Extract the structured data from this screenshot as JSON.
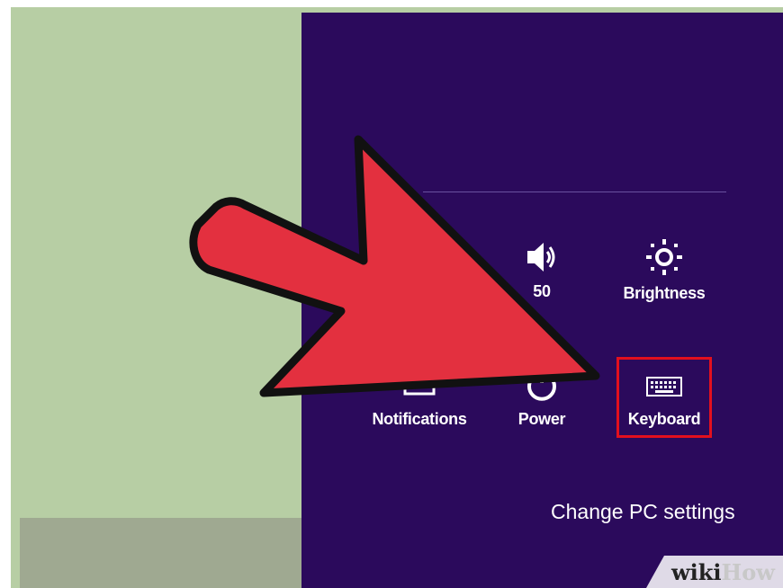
{
  "charm_panel": {
    "tiles_row1": [
      {
        "label": "50",
        "icon": "volume-icon"
      },
      {
        "label": "Brightness",
        "icon": "brightness-icon"
      }
    ],
    "tiles_row2": [
      {
        "label": "Notifications",
        "icon": "notifications-icon"
      },
      {
        "label": "Power",
        "icon": "power-icon"
      },
      {
        "label": "Keyboard",
        "icon": "keyboard-icon"
      }
    ],
    "change_pc_settings": "Change PC settings"
  },
  "highlight": {
    "target": "Keyboard",
    "color": "#e3101e"
  },
  "pointer_arrow": {
    "color": "#e3303f",
    "outline": "#111111"
  },
  "watermark": {
    "prefix": "wiki",
    "suffix": "How"
  },
  "colors": {
    "charm_bg": "#2b0a5c",
    "desktop_bg": "#b7cea4"
  }
}
